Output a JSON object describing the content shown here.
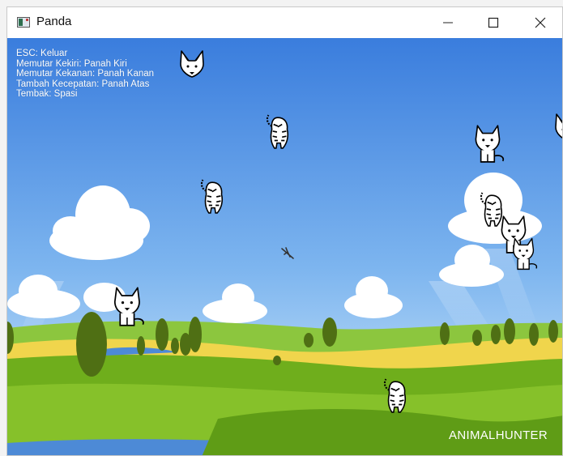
{
  "window": {
    "title": "Panda",
    "app_icon": "window-app-icon",
    "controls": [
      "minimize-icon",
      "maximize-icon",
      "close-icon"
    ]
  },
  "hud": {
    "lines": [
      "ESC: Keluar",
      "Memutar Kekiri: Panah Kiri",
      "Memutar Kekanan: Panah Kanan",
      "Tambah Kecepatan: Panah Atas",
      "Tembak: Spasi"
    ]
  },
  "brand": "ANIMALHUNTER",
  "sprites": {
    "fox": "fox-icon",
    "tiger": "tiger-icon",
    "wolf": "wolf-icon",
    "ship": "player-ship-icon"
  },
  "colors": {
    "sky_top": "#3c7fdf",
    "sky_bottom": "#cfe8fb",
    "grass": "#7dbb1f",
    "field_yellow": "#f1d64e",
    "tree": "#4f6f14",
    "water": "#4d8ad6",
    "text": "#ffffff"
  }
}
